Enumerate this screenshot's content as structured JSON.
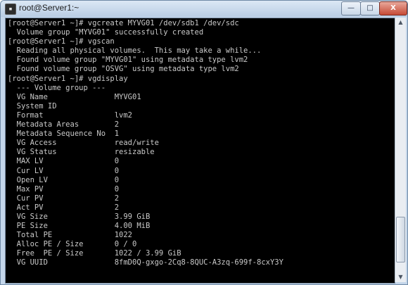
{
  "window": {
    "title": "root@Server1:~",
    "app_icon": "terminal-icon",
    "controls": {
      "minimize": "—",
      "maximize": "□",
      "close": "X"
    }
  },
  "terminal": {
    "lines": [
      "[root@Server1 ~]# vgcreate MYVG01 /dev/sdb1 /dev/sdc",
      "  Volume group \"MYVG01\" successfully created",
      "[root@Server1 ~]# vgscan",
      "  Reading all physical volumes.  This may take a while...",
      "  Found volume group \"MYVG01\" using metadata type lvm2",
      "  Found volume group \"OSVG\" using metadata type lvm2",
      "[root@Server1 ~]# vgdisplay",
      "  --- Volume group ---",
      "  VG Name               MYVG01",
      "  System ID",
      "  Format                lvm2",
      "  Metadata Areas        2",
      "  Metadata Sequence No  1",
      "  VG Access             read/write",
      "  VG Status             resizable",
      "  MAX LV                0",
      "  Cur LV                0",
      "  Open LV               0",
      "  Max PV                0",
      "  Cur PV                2",
      "  Act PV                2",
      "  VG Size               3.99 GiB",
      "  PE Size               4.00 MiB",
      "  Total PE              1022",
      "  Alloc PE / Size       0 / 0",
      "  Free  PE / Size       1022 / 3.99 GiB",
      "  VG UUID               8fmD0Q-gxgo-2Cq8-8QUC-A3zq-699f-8cxY3Y"
    ]
  },
  "scrollbar": {
    "up": "▲",
    "down": "▼"
  }
}
